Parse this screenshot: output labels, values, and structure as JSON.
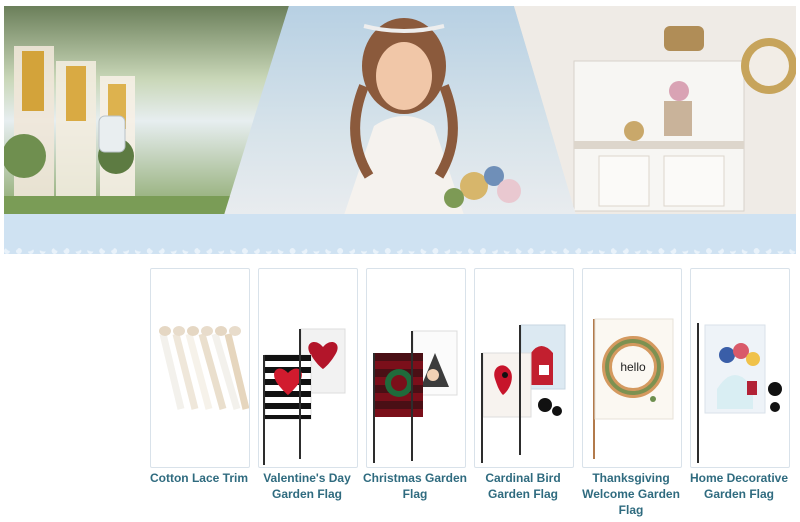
{
  "banner": {
    "panels": [
      "wedding-aisle",
      "bride-portrait",
      "vintage-shelf"
    ],
    "lace_color": "#cfe2f2"
  },
  "products": [
    {
      "name": "Cotton Lace Trim",
      "lines": [
        "Cotton Lace Trim"
      ]
    },
    {
      "name": "Valentine's Day Garden Flag",
      "lines": [
        "Valentine's Day",
        "Garden Flag"
      ]
    },
    {
      "name": "Christmas Garden Flag",
      "lines": [
        "Christmas Garden",
        "Flag"
      ]
    },
    {
      "name": "Cardinal Bird Garden Flag",
      "lines": [
        "Cardinal Bird",
        "Garden Flag"
      ]
    },
    {
      "name": "Thanksgiving Welcome Garden Flag",
      "lines": [
        "Thanksgiving",
        "Welcome Garden",
        "Flag"
      ]
    },
    {
      "name": "Home Decorative Garden Flag",
      "lines": [
        "Home Decorative",
        "Garden Flag"
      ]
    }
  ],
  "colors": {
    "label_text": "#2f6b7f",
    "tile_border": "#d9e2ea"
  }
}
